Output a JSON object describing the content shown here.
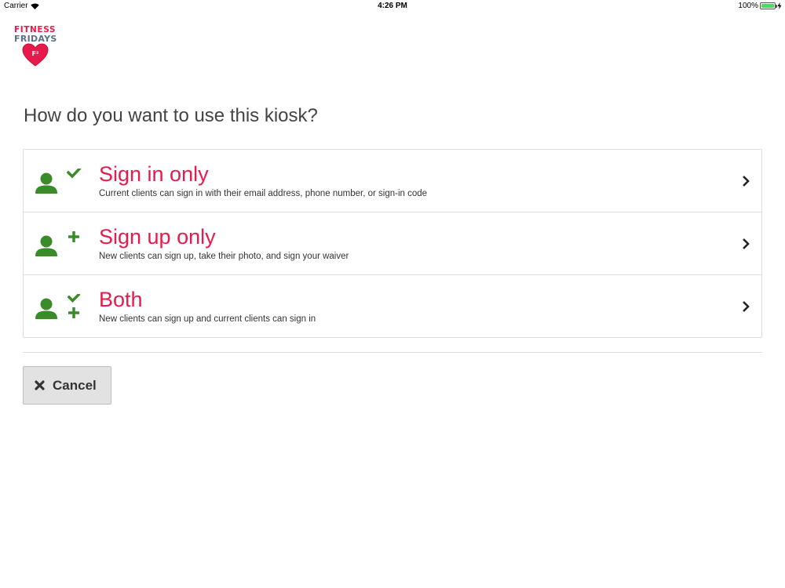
{
  "status_bar": {
    "carrier": "Carrier",
    "time": "4:26 PM",
    "battery": "100%"
  },
  "logo": {
    "line1": "FITNESS",
    "line2": "FRIDAYS",
    "mark": "F²"
  },
  "page": {
    "heading": "How do you want to use this kiosk?"
  },
  "options": [
    {
      "title": "Sign in only",
      "description": "Current clients can sign in with their email address, phone number, or sign-in code",
      "icon": "user-check-icon"
    },
    {
      "title": "Sign up only",
      "description": "New clients can sign up, take their photo, and sign your waiver",
      "icon": "user-plus-icon"
    },
    {
      "title": "Both",
      "description": "New clients can sign up and current clients can sign in",
      "icon": "user-check-plus-icon"
    }
  ],
  "cancel": {
    "label": "Cancel",
    "icon": "close-icon"
  },
  "colors": {
    "accent": "#e8194b",
    "icon_green": "#3b8b2b",
    "logo_slate": "#5b6f88"
  }
}
